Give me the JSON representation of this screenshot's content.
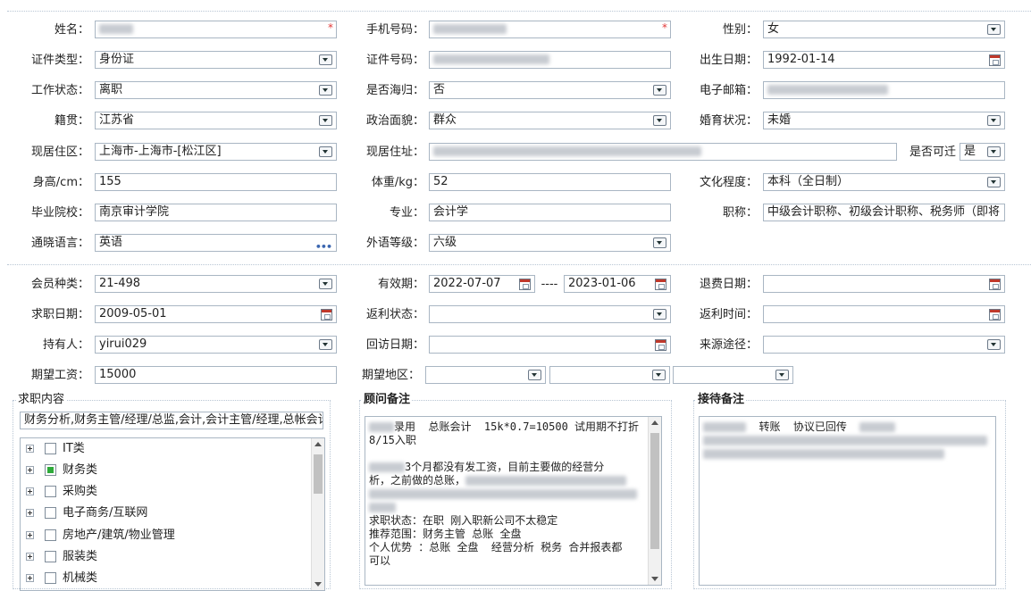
{
  "colors": {
    "border": "#a9b6c3",
    "required": "#e23a3a",
    "checked": "#2eaa3a"
  },
  "personal": {
    "name_label": "姓名：",
    "phone_label": "手机号码：",
    "gender_label": "性别：",
    "gender": "女",
    "id_type_label": "证件类型：",
    "id_type": "身份证",
    "id_no_label": "证件号码：",
    "birth_label": "出生日期：",
    "birth": "1992-01-14",
    "work_status_label": "工作状态：",
    "work_status": "离职",
    "returnee_label": "是否海归：",
    "returnee": "否",
    "email_label": "电子邮箱：",
    "native_label": "籍贯：",
    "native": "江苏省",
    "political_label": "政治面貌：",
    "political": "群众",
    "marital_label": "婚育状况：",
    "marital": "未婚",
    "residence_label": "现居住区：",
    "residence": "上海市-上海市-[松江区]",
    "address_label": "现居住址：",
    "relocate_label": "是否可迁",
    "relocate": "是",
    "height_label": "身高/cm：",
    "height": "155",
    "weight_label": "体重/kg：",
    "weight": "52",
    "education_label": "文化程度：",
    "education": "本科（全日制）",
    "school_label": "毕业院校：",
    "school": "南京审计学院",
    "major_label": "专业：",
    "major": "会计学",
    "title_label": "职称：",
    "title": "中级会计职称、初级会计职称、税务师（即将",
    "language_label": "通晓语言：",
    "language": "英语",
    "lang_level_label": "外语等级：",
    "lang_level": "六级"
  },
  "membership": {
    "type_label": "会员种类：",
    "type": "21-498",
    "valid_label": "有效期：",
    "valid_from": "2022-07-07",
    "valid_sep": "----",
    "valid_to": "2023-01-06",
    "refund_label": "退费日期：",
    "apply_label": "求职日期：",
    "apply_date": "2009-05-01",
    "rebate_status_label": "返利状态：",
    "rebate_time_label": "返利时间：",
    "holder_label": "持有人：",
    "holder": "yirui029",
    "revisit_label": "回访日期：",
    "source_label": "来源途径：",
    "salary_label": "期望工资：",
    "salary": "15000",
    "region_label": "期望地区："
  },
  "job": {
    "title": "求职内容",
    "summary": "财务分析,财务主管/经理/总监,会计,会计主管/经理,总帐会计",
    "tree": [
      {
        "label": "IT类",
        "checked": false
      },
      {
        "label": "财务类",
        "checked": true
      },
      {
        "label": "采购类",
        "checked": false
      },
      {
        "label": "电子商务/互联网",
        "checked": false
      },
      {
        "label": "房地产/建筑/物业管理",
        "checked": false
      },
      {
        "label": "服装类",
        "checked": false
      },
      {
        "label": "机械类",
        "checked": false
      }
    ]
  },
  "advisor": {
    "title": "顾问备注",
    "l1": "录用  总账会计  15k*0.7=10500 试用期不打折",
    "l2": "8/15入职",
    "l3": "3个月都没有发工资，目前主要做的经营分",
    "l4": "析，之前做的总账，",
    "l5": "求职状态：在职 刚入职新公司不太稳定",
    "l6": "推荐范围：财务主管 总账 全盘",
    "l7": "个人优势 ：总账 全盘  经营分析 税务 合并报表都",
    "l8": "可以"
  },
  "reception": {
    "title": "接待备注",
    "l1": "转账  协议已回传"
  }
}
